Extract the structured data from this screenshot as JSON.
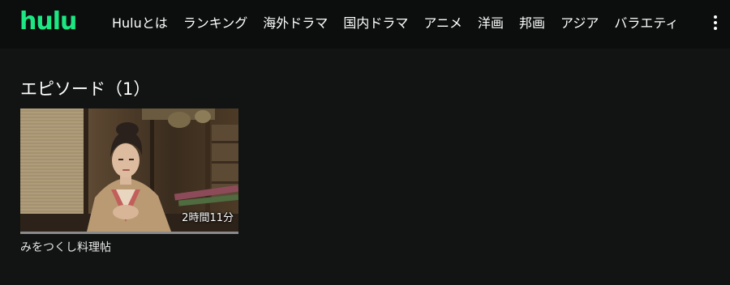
{
  "brand": {
    "logo_text": "hulu",
    "accent_color": "#1ce783"
  },
  "nav": {
    "items": [
      {
        "label": "Huluとは"
      },
      {
        "label": "ランキング"
      },
      {
        "label": "海外ドラマ"
      },
      {
        "label": "国内ドラマ"
      },
      {
        "label": "アニメ"
      },
      {
        "label": "洋画"
      },
      {
        "label": "邦画"
      },
      {
        "label": "アジア"
      },
      {
        "label": "バラエティ"
      }
    ],
    "more_icon": "more-vertical-icon"
  },
  "episodes": {
    "section_title": "エピソード（1）",
    "items": [
      {
        "title": "みをつくし料理帖",
        "duration": "2時間11分"
      }
    ]
  }
}
